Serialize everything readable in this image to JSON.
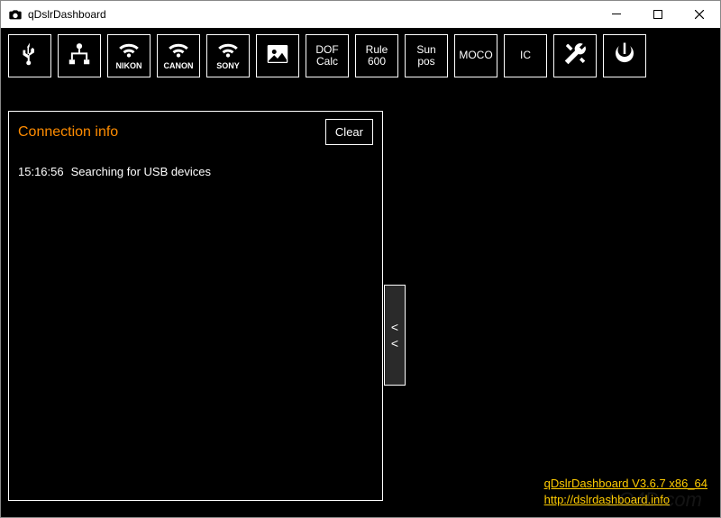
{
  "window": {
    "title": "qDslrDashboard"
  },
  "toolbar": {
    "nikon_label": "NIKON",
    "canon_label": "CANON",
    "sony_label": "SONY",
    "dof_calc_l1": "DOF",
    "dof_calc_l2": "Calc",
    "rule600_l1": "Rule",
    "rule600_l2": "600",
    "sunpos_l1": "Sun",
    "sunpos_l2": "pos",
    "moco_label": "MOCO",
    "ic_label": "IC"
  },
  "panel": {
    "title": "Connection info",
    "clear_label": "Clear"
  },
  "log": {
    "entries": [
      {
        "time": "15:16:56",
        "msg": "Searching for USB devices"
      }
    ]
  },
  "footer": {
    "version": "qDslrDashboard V3.6.7 x86_64",
    "site": "http://dslrdashboard.info"
  },
  "watermark": "LO4D.com"
}
